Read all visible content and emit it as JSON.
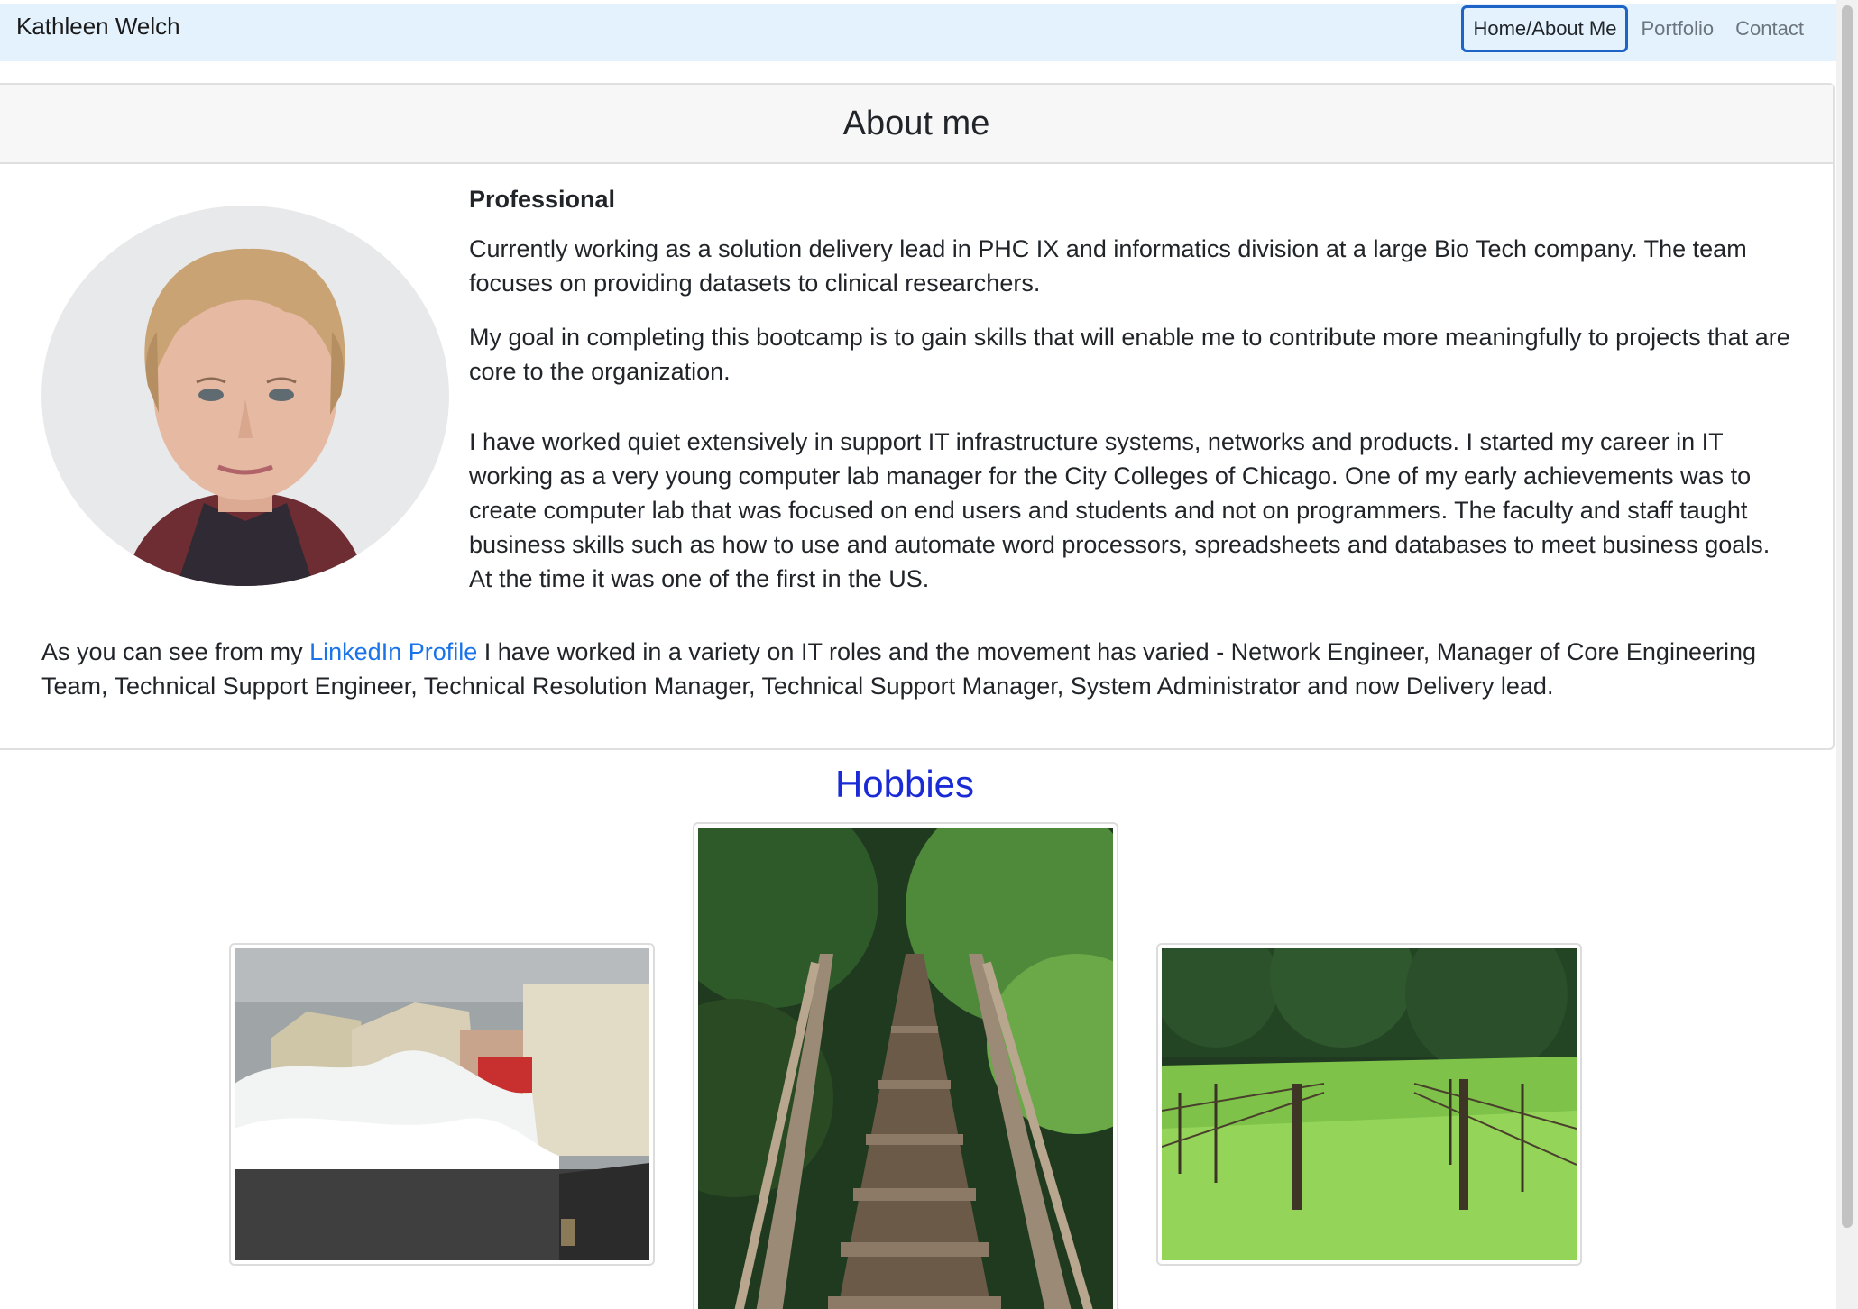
{
  "navbar": {
    "brand": "Kathleen Welch",
    "links": [
      "Home/About Me",
      "Portfolio",
      "Contact"
    ]
  },
  "about": {
    "title": "About me",
    "subheading": "Professional",
    "paragraphs": [
      "Currently working as a solution delivery lead in PHC IX and informatics division at a large Bio Tech company. The team focuses on providing datasets to clinical researchers.",
      "My goal in completing this bootcamp is to gain skills that will enable me to contribute more meaningfully to projects that are core to the organization.",
      "I have worked quiet extensively in support IT infrastructure systems, networks and products. I started my career in IT working as a very young computer lab manager for the City Colleges of Chicago. One of my early achievements was to create computer lab that was focused on end users and students and not on programmers. The faculty and staff taught business skills such as how to use and automate word processors, spreadsheets and databases to meet business goals. At the time it was one of the first in the US."
    ],
    "linkedin_prefix": "As you can see from my",
    "linkedin_text": "LinkedIn Profile",
    "linkedin_suffix": "I have worked in a variety on IT roles and the movement has varied - Network Engineer, Manager of Core Engineering Team, Technical Support Engineer, Technical Resolution Manager, Technical Support Manager, System Administrator and now Delivery lead."
  },
  "hobbies": {
    "title": "Hobbies"
  },
  "colors": {
    "navbar_bg": "#e3f2fd",
    "hobbies_title": "#1a2ad6",
    "link": "#1a73e8",
    "active_border": "#1e63c6"
  }
}
